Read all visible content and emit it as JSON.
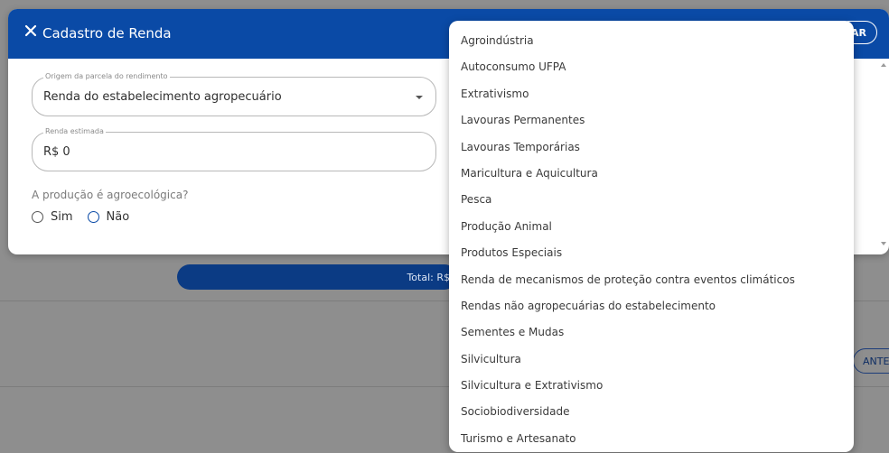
{
  "background": {
    "total_label": "Total: R$",
    "ante_button": "ANTE"
  },
  "modal": {
    "title": "Cadastro de Renda",
    "header_button": "AR",
    "origin_field": {
      "legend": "Origem da parcela do rendimento",
      "value": "Renda do estabelecimento agropecuário"
    },
    "income_field": {
      "legend": "Renda estimada",
      "value": "R$ 0"
    },
    "agroecological": {
      "question": "A produção é agroecológica?",
      "options": [
        "Sim",
        "Não"
      ]
    }
  },
  "dropdown": {
    "items": [
      "Agroindústria",
      "Autoconsumo UFPA",
      "Extrativismo",
      "Lavouras Permanentes",
      "Lavouras Temporárias",
      "Maricultura e Aquicultura",
      "Pesca",
      "Produção Animal",
      "Produtos Especiais",
      "Renda de mecanismos de proteção contra eventos climáticos",
      "Rendas não agropecuárias do estabelecimento",
      "Sementes e Mudas",
      "Silvicultura",
      "Silvicultura e Extrativismo",
      "Sociobiodiversidade",
      "Turismo e Artesanato"
    ]
  },
  "colors": {
    "header": "#0a4aa6",
    "total_pill": "#0b3b84",
    "overlay": "#8e8e8e"
  },
  "icons": [
    "close-icon",
    "chevron-down-icon"
  ]
}
